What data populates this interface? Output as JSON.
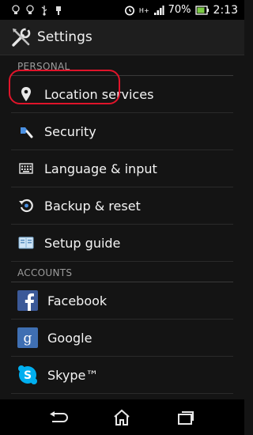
{
  "status_bar": {
    "network_type": "H+",
    "battery_percent": "70%",
    "time": "2:13",
    "left_icons": [
      "bulb-icon",
      "bulb-icon",
      "usb-icon",
      "tool-icon"
    ],
    "right_icons": [
      "alarm-icon",
      "signal-icon",
      "battery-icon"
    ]
  },
  "action_bar": {
    "title": "Settings",
    "icon": "settings-tools-icon"
  },
  "sections": [
    {
      "header": "PERSONAL",
      "items": [
        {
          "label": "Location services",
          "icon": "location-pin-icon"
        },
        {
          "label": "Security",
          "icon": "security-key-icon"
        },
        {
          "label": "Language & input",
          "icon": "keyboard-icon"
        },
        {
          "label": "Backup & reset",
          "icon": "backup-restore-icon"
        },
        {
          "label": "Setup guide",
          "icon": "setup-guide-icon"
        }
      ]
    },
    {
      "header": "ACCOUNTS",
      "items": [
        {
          "label": "Facebook",
          "icon": "facebook-icon"
        },
        {
          "label": "Google",
          "icon": "google-icon"
        },
        {
          "label": "Skype™",
          "icon": "skype-icon"
        }
      ]
    }
  ],
  "nav_bar": {
    "buttons": [
      "back-icon",
      "home-icon",
      "recent-apps-icon"
    ]
  },
  "colors": {
    "highlight": "#e0142a",
    "facebook": "#3b5998",
    "google": "#3f6fb2",
    "skype": "#00aff0"
  }
}
